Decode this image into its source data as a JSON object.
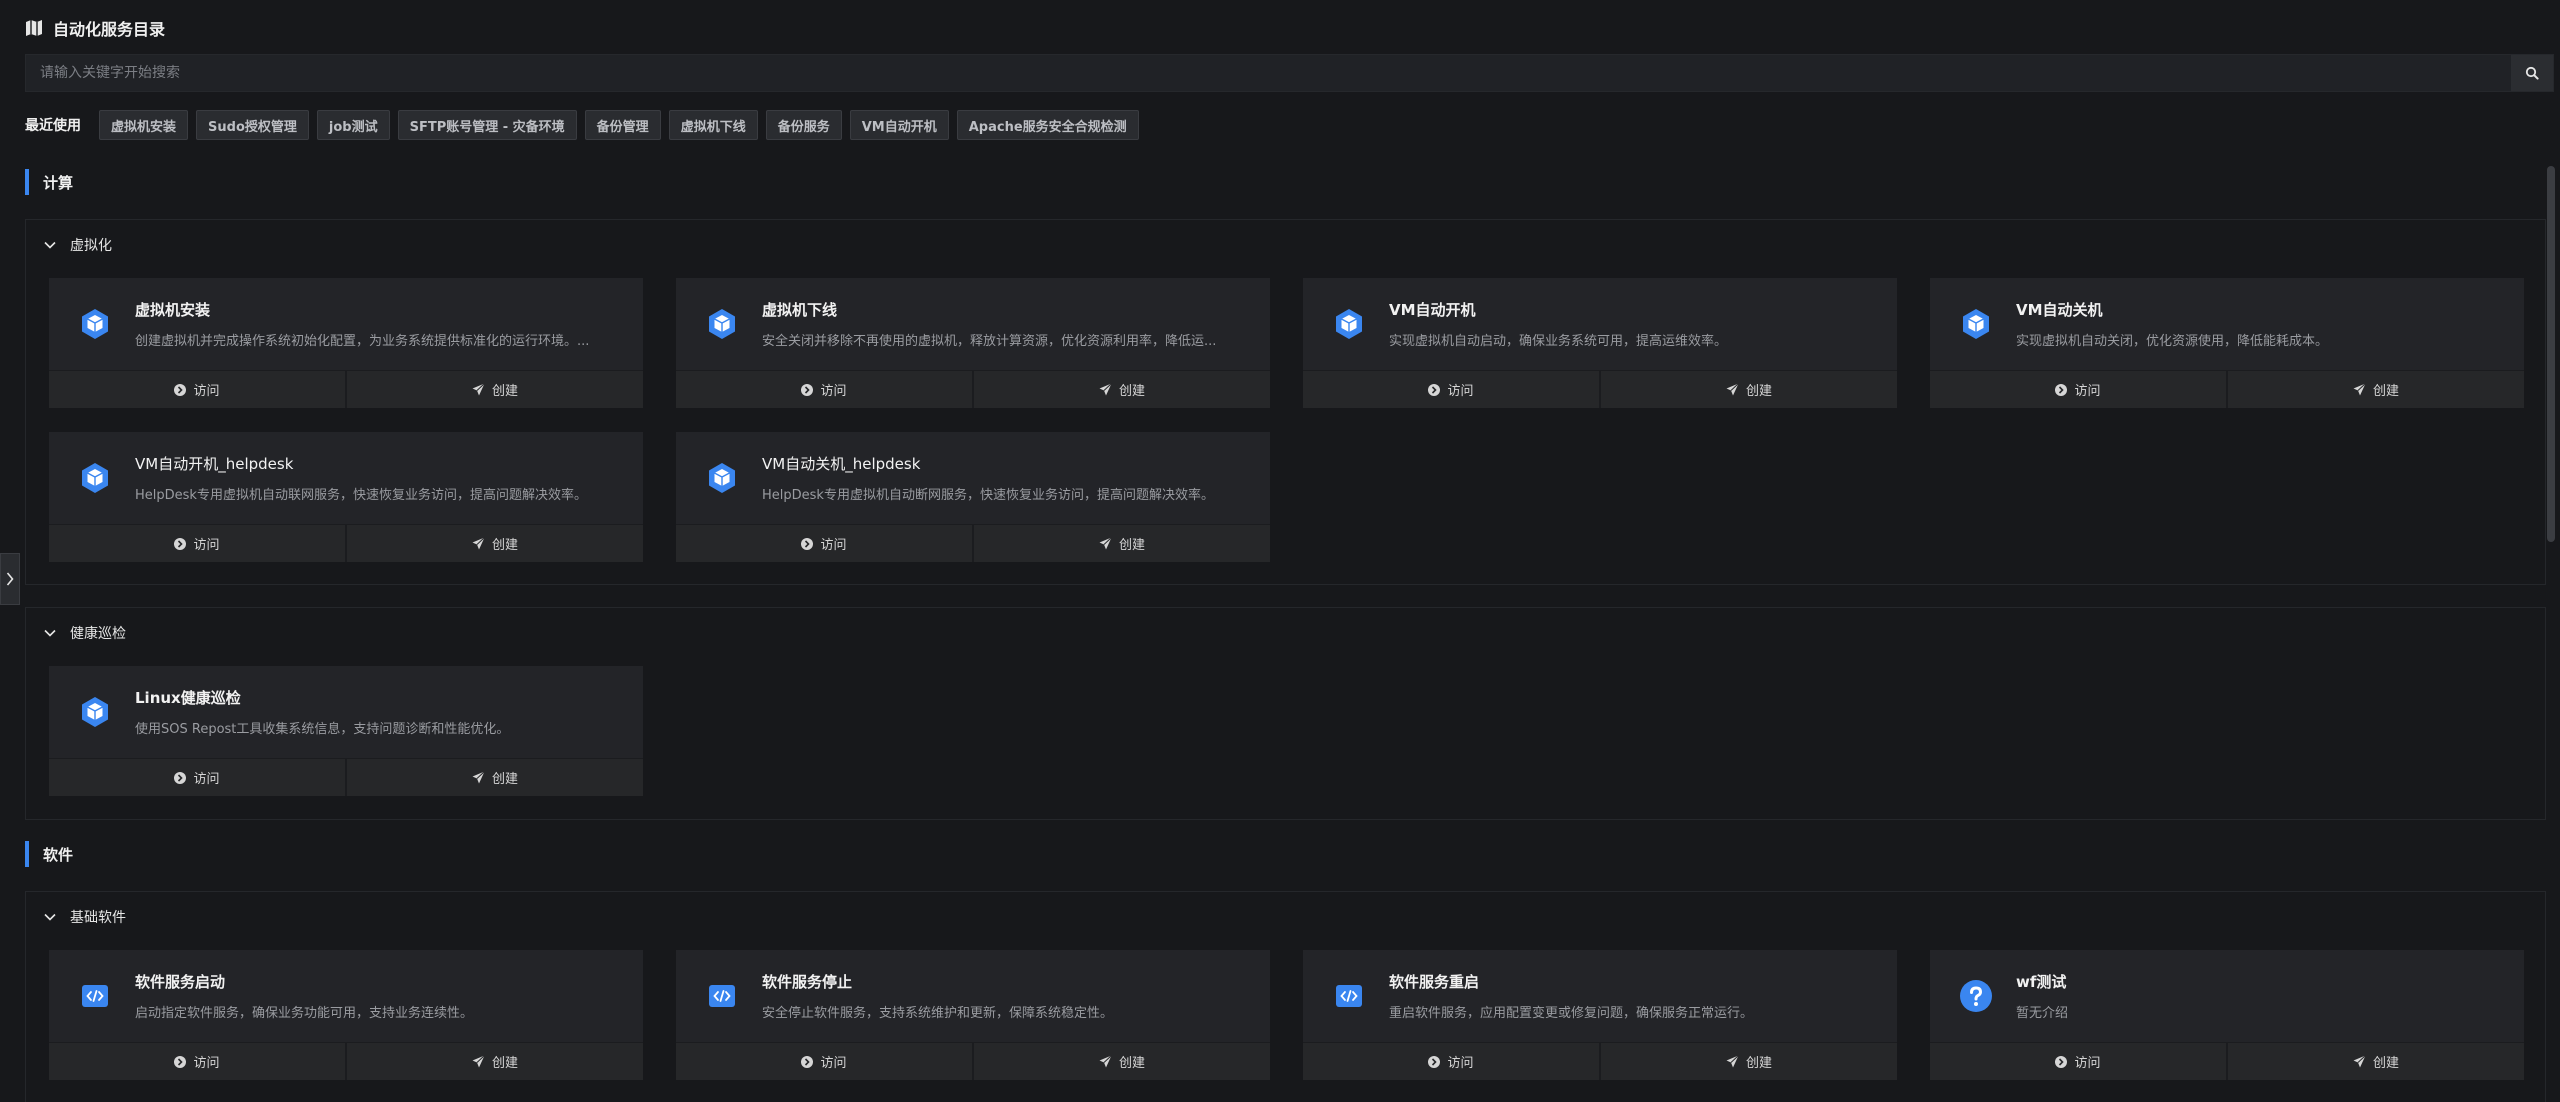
{
  "header": {
    "title": "自动化服务目录",
    "icon": "map-icon"
  },
  "search": {
    "placeholder": "请输入关键字开始搜索",
    "icon": "search-icon"
  },
  "recent": {
    "label": "最近使用",
    "tags": [
      "虚拟机安装",
      "Sudo授权管理",
      "job测试",
      "SFTP账号管理 - 灾备环境",
      "备份管理",
      "虚拟机下线",
      "备份服务",
      "VM自动开机",
      "Apache服务安全合规检测"
    ]
  },
  "actions": {
    "visit": "访问",
    "create": "创建"
  },
  "sections": {
    "compute": {
      "title": "计算",
      "groups": {
        "virtualization": {
          "title": "虚拟化",
          "cards": [
            {
              "name": "虚拟机安装",
              "desc": "创建虚拟机并完成操作系统初始化配置，为业务系统提供标准化的运行环境。...",
              "icon": "cube-icon"
            },
            {
              "name": "虚拟机下线",
              "desc": "安全关闭并移除不再使用的虚拟机，释放计算资源，优化资源利用率，降低运...",
              "icon": "cube-icon"
            },
            {
              "name": "VM自动开机",
              "desc": "实现虚拟机自动启动，确保业务系统可用，提高运维效率。",
              "icon": "cube-icon"
            },
            {
              "name": "VM自动关机",
              "desc": "实现虚拟机自动关闭，优化资源使用，降低能耗成本。",
              "icon": "cube-icon"
            },
            {
              "name": "VM自动开机_helpdesk",
              "desc": "HelpDesk专用虚拟机自动联网服务，快速恢复业务访问，提高问题解决效率。",
              "icon": "cube-icon"
            },
            {
              "name": "VM自动关机_helpdesk",
              "desc": "HelpDesk专用虚拟机自动断网服务，快速恢复业务访问，提高问题解决效率。",
              "icon": "cube-icon"
            }
          ]
        },
        "health": {
          "title": "健康巡检",
          "cards": [
            {
              "name": "Linux健康巡检",
              "desc": "使用SOS Repost工具收集系统信息，支持问题诊断和性能优化。",
              "icon": "cube-icon"
            }
          ]
        }
      }
    },
    "software": {
      "title": "软件",
      "groups": {
        "basic": {
          "title": "基础软件",
          "cards": [
            {
              "name": "软件服务启动",
              "desc": "启动指定软件服务，确保业务功能可用，支持业务连续性。",
              "icon": "code-icon"
            },
            {
              "name": "软件服务停止",
              "desc": "安全停止软件服务，支持系统维护和更新，保障系统稳定性。",
              "icon": "code-icon"
            },
            {
              "name": "软件服务重启",
              "desc": "重启软件服务，应用配置变更或修复问题，确保服务正常运行。",
              "icon": "code-icon"
            },
            {
              "name": "wf测试",
              "desc": "暂无介绍",
              "icon": "question-icon"
            }
          ]
        }
      }
    }
  },
  "colors": {
    "accent": "#3a86f0",
    "background": "#17181b",
    "card": "#232428"
  }
}
